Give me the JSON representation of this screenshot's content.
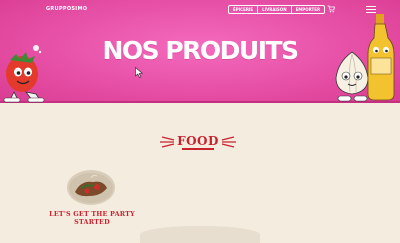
{
  "brand": {
    "logo_text": "GRUPPOSIMO"
  },
  "nav": {
    "pills": [
      {
        "label": "ÉPICERIE"
      },
      {
        "label": "LIVRAISON"
      },
      {
        "label": "EMPORTER"
      }
    ],
    "icons": [
      "cart-icon",
      "hamburger-menu-icon"
    ]
  },
  "hero": {
    "title": "NOS PRODUITS"
  },
  "section": {
    "heading": "FOOD"
  },
  "products": [
    {
      "title": "LET'S GET THE PARTY STARTED"
    }
  ],
  "colors": {
    "hero_pink": "#e650a6",
    "cream_background": "#f4ecdf",
    "accent_red": "#c8222f",
    "white": "#ffffff"
  }
}
